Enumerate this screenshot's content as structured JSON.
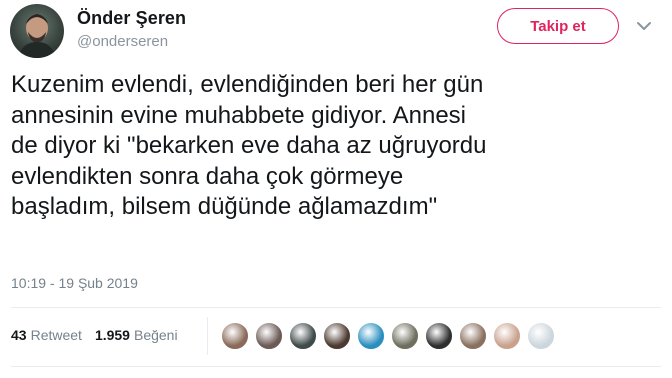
{
  "user": {
    "display_name": "Önder Şeren",
    "handle": "@onderseren"
  },
  "follow_button": {
    "label": "Takip et",
    "color": "#e0245e"
  },
  "tweet": {
    "lines": [
      "Kuzenim evlendi, evlendiğinden beri her gün",
      "annesinin evine muhabbete gidiyor. Annesi",
      "de diyor ki \"bekarken eve daha az uğruyordu",
      "evlendikten sonra daha çok görmeye",
      "başladım, bilsem düğünde ağlamazdım\""
    ],
    "timestamp": "10:19 - 19 Şub 2019"
  },
  "stats": {
    "retweet_count": "43",
    "retweet_label": "Retweet",
    "like_count": "1.959",
    "like_label": "Beğeni"
  },
  "likers": [
    {
      "name": "liker-avatar-1",
      "color": "#8a6a5a"
    },
    {
      "name": "liker-avatar-2",
      "color": "#6b5a55"
    },
    {
      "name": "liker-avatar-3",
      "color": "#3f4a4a"
    },
    {
      "name": "liker-avatar-4",
      "color": "#4c3a30"
    },
    {
      "name": "liker-avatar-5",
      "color": "#2a8fbf"
    },
    {
      "name": "liker-avatar-6",
      "color": "#6f6f5f"
    },
    {
      "name": "liker-avatar-7",
      "color": "#2f2f2f"
    },
    {
      "name": "liker-avatar-8",
      "color": "#8a7060"
    },
    {
      "name": "liker-avatar-9",
      "color": "#c9a28e"
    },
    {
      "name": "liker-avatar-10",
      "color": "#ccd6dd"
    }
  ]
}
